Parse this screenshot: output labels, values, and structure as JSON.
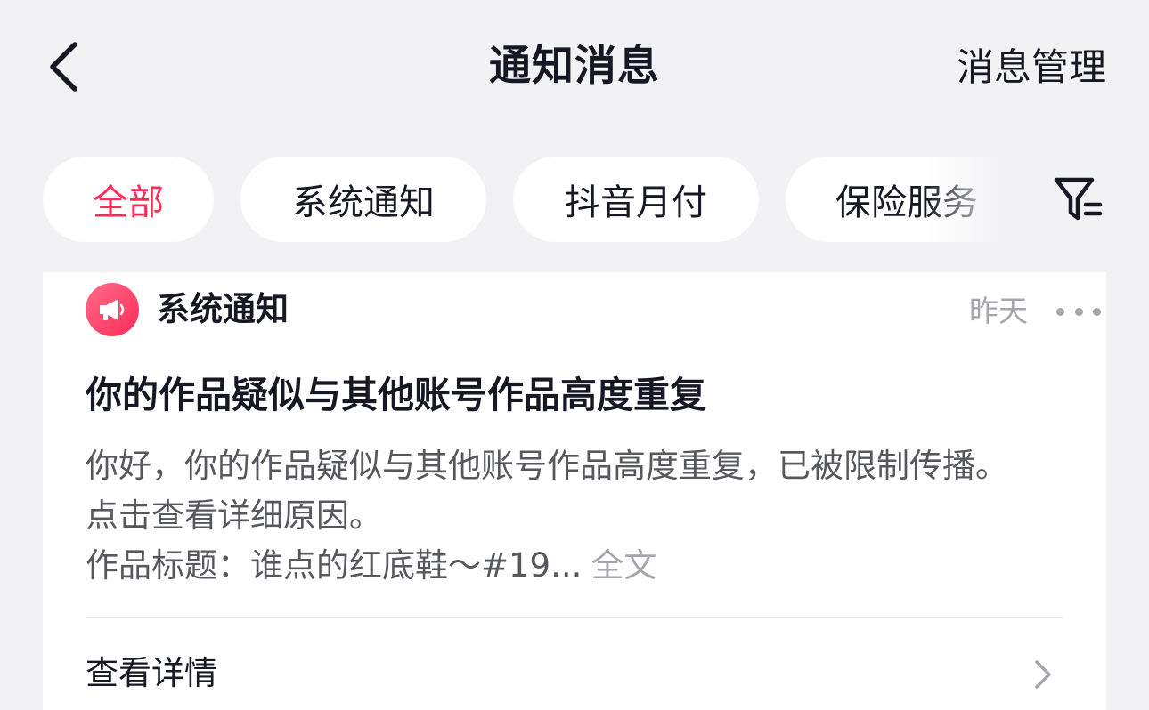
{
  "header": {
    "title": "通知消息",
    "manage_label": "消息管理",
    "back_icon": "chevron-left-icon"
  },
  "tabs": [
    {
      "label": "全部",
      "active": true
    },
    {
      "label": "系统通知",
      "active": false
    },
    {
      "label": "抖音月付",
      "active": false
    },
    {
      "label": "保险服务",
      "active": false
    }
  ],
  "filter_icon": "filter-icon",
  "colors": {
    "accent": "#fe2c55",
    "background": "#f2f2f5",
    "card": "#ffffff",
    "text_primary": "#161823",
    "text_secondary": "#57585d",
    "text_muted": "#a5a6ab"
  },
  "notification": {
    "source_icon": "megaphone-icon",
    "source_label": "系统通知",
    "time": "昨天",
    "more_icon": "more-dots-icon",
    "title": "你的作品疑似与其他账号作品高度重复",
    "body_line1": "你好，你的作品疑似与其他账号作品高度重复，已被限制传播。",
    "body_line2": "点击查看详细原因。",
    "body_line3": "作品标题：谁点的红底鞋～#19...",
    "full_text_label": "全文",
    "detail_label": "查看详情",
    "detail_icon": "chevron-right-icon"
  }
}
